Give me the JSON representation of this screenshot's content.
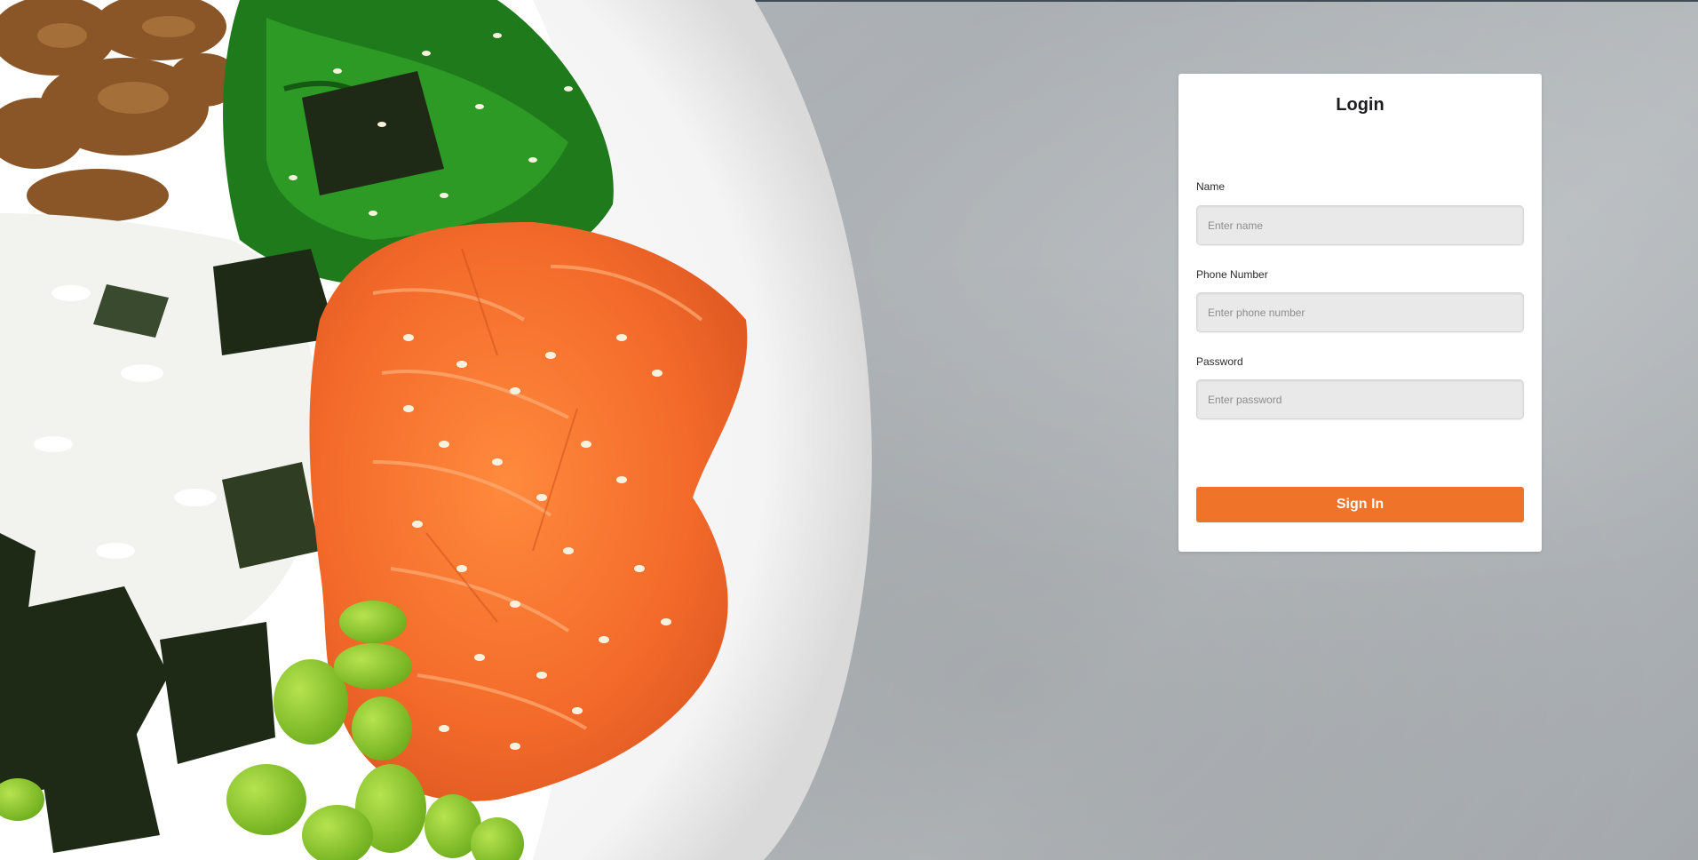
{
  "login": {
    "title": "Login",
    "fields": [
      {
        "label": "Name",
        "placeholder": "Enter name",
        "value": ""
      },
      {
        "label": "Phone Number",
        "placeholder": "Enter phone number",
        "value": ""
      },
      {
        "label": "Password",
        "placeholder": "Enter password",
        "value": ""
      }
    ],
    "submit_label": "Sign In"
  },
  "colors": {
    "accent": "#f0732a",
    "background": "#afb4b8",
    "card": "#ffffff",
    "input_fill": "#e9e9e9"
  }
}
